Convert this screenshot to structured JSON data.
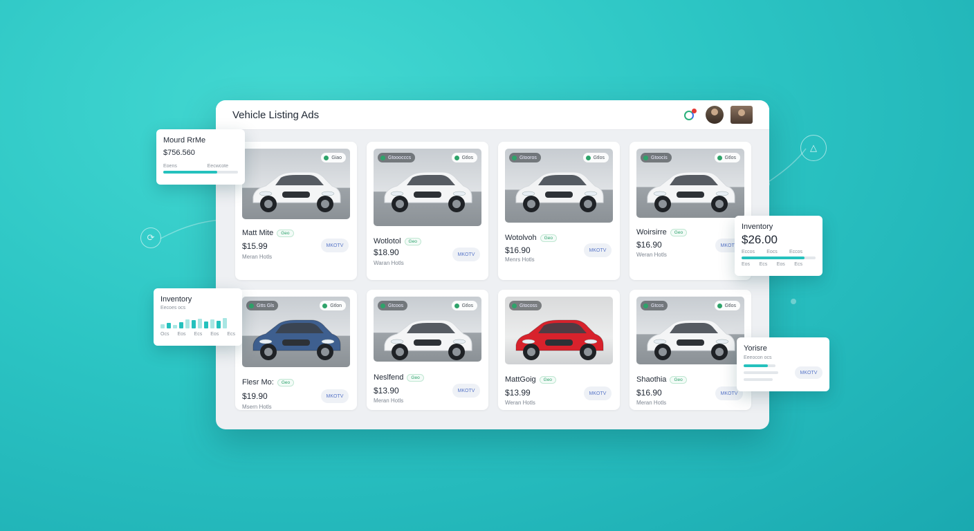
{
  "app": {
    "title": "Vehicle Listing Ads"
  },
  "listings": [
    {
      "name": "Matt Mite",
      "tag": "Geo",
      "price": "$15.99",
      "sub": "Meran Hotls",
      "button": "MKOTV",
      "pill_left": "",
      "pill_right": "Giao",
      "color": "#f4f5f6"
    },
    {
      "name": "Wotlotol",
      "tag": "Geo",
      "price": "$18.90",
      "sub": "Waran Hotls",
      "button": "MKOTV",
      "pill_left": "Gtooocccs",
      "pill_right": "Gtlos",
      "color": "#f4f5f6"
    },
    {
      "name": "Wotolvoh",
      "tag": "Geo",
      "price": "$16.90",
      "sub": "Menrs Hotls",
      "button": "MKOTV",
      "pill_left": "Gtooros",
      "pill_right": "Gtlos",
      "color": "#f2f3f4"
    },
    {
      "name": "Woirsirre",
      "tag": "Geo",
      "price": "$16.90",
      "sub": "Weran Hotls",
      "button": "MKOTV",
      "pill_left": "Gtoocis",
      "pill_right": "Gtlos",
      "color": "#f4f5f6"
    },
    {
      "name": "Flesr Mo:",
      "tag": "Geo",
      "price": "$19.90",
      "sub": "Msern Hotls",
      "button": "MKOTV",
      "pill_left": "Gtts Gls",
      "pill_right": "Gtlon",
      "color": "#3e5f8f"
    },
    {
      "name": "Neslfend",
      "tag": "Geo",
      "price": "$13.90",
      "sub": "Meran Hotls",
      "button": "MKOTV",
      "pill_left": "Gtcoos",
      "pill_right": "Gtlos",
      "color": "#f4f5f6"
    },
    {
      "name": "MattGoig",
      "tag": "Geo",
      "price": "$13.99",
      "sub": "Weran Hotls",
      "button": "MKOTV",
      "pill_left": "Gtocoss",
      "pill_right": "",
      "color": "#d8222c"
    },
    {
      "name": "Shaothia",
      "tag": "Geo",
      "price": "$16.90",
      "sub": "Meran Hotls",
      "button": "MKOTV",
      "pill_left": "Gtcos",
      "pill_right": "Gtlos",
      "color": "#f4f5f6"
    }
  ],
  "float_top_left": {
    "title": "Mourd RrMe",
    "value": "$756.560",
    "label_left": "Eoens",
    "label_right": "Eecwcote",
    "progress": 0.72
  },
  "float_inventory_left": {
    "title": "Inventory",
    "subtitle": "Eecoes ocs",
    "bars": [
      0.35,
      0.45,
      0.3,
      0.5,
      0.7,
      0.65,
      0.8,
      0.55,
      0.75,
      0.6,
      0.85
    ],
    "axis": [
      "Ocs",
      "Eos",
      "Ecs",
      "Eos",
      "Ecs"
    ]
  },
  "float_inventory_right": {
    "title": "Inventory",
    "value": "$26.00",
    "label_left": "Eccos",
    "label_mid": "Eocs",
    "label_right": "Eccos",
    "progress": 0.85,
    "axis": [
      "Eos",
      "Ecs",
      "Eos",
      "Ecs"
    ]
  },
  "float_yorisre": {
    "title": "Yorisre",
    "subtitle": "Eeeocon ocs",
    "button": "MKOTV",
    "progress": 0.75
  }
}
